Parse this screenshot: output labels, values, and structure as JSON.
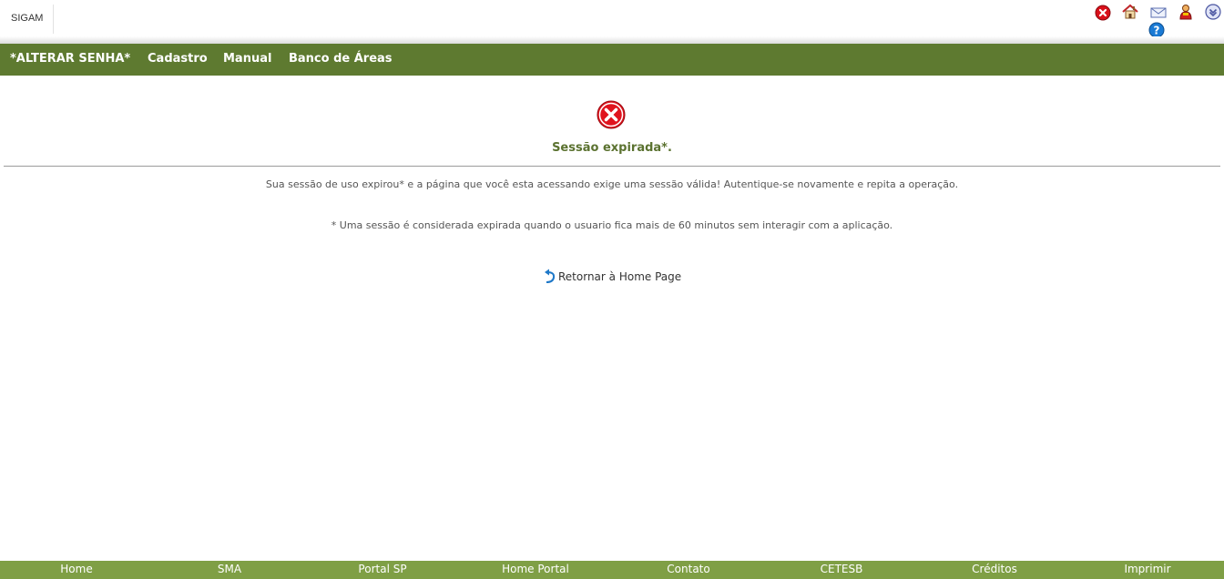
{
  "header": {
    "app_name": "SIGAM",
    "icons": [
      "close-icon",
      "home-icon",
      "mail-icon",
      "user-icon",
      "collapse-icon",
      "help-icon"
    ]
  },
  "menu": {
    "items": [
      {
        "label": "*ALTERAR SENHA*"
      },
      {
        "label": "Cadastro"
      },
      {
        "label": "Manual"
      },
      {
        "label": "Banco de Áreas"
      }
    ]
  },
  "main": {
    "title": "Sessão expirada*.",
    "message": "Sua sessão de uso expirou* e a página que você esta acessando exige uma sessão válida! Autentique-se novamente e repita a operação.",
    "note": "* Uma sessão é considerada expirada quando o usuario fica mais de 60 minutos sem interagir com a aplicação.",
    "return_link": "Retornar à Home Page"
  },
  "footer": {
    "links": [
      {
        "label": "Home"
      },
      {
        "label": "SMA"
      },
      {
        "label": "Portal SP"
      },
      {
        "label": "Home Portal"
      },
      {
        "label": "Contato"
      },
      {
        "label": "CETESB"
      },
      {
        "label": "Créditos"
      },
      {
        "label": "Imprimir"
      }
    ]
  },
  "colors": {
    "menu_bg": "#5e7a30",
    "footer_bg": "#7f9f45",
    "title": "#5b7230",
    "error_red": "#e0141e"
  }
}
